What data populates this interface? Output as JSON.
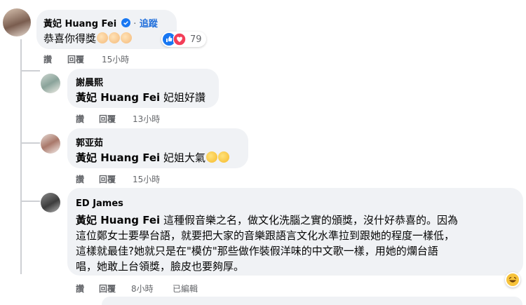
{
  "comments": [
    {
      "author": "黃妃 Huang Fei",
      "follow_label": "追蹤",
      "text": "恭喜你得獎",
      "reaction_count": "79",
      "actions": {
        "like": "讚",
        "reply": "回覆",
        "time": "15小時"
      }
    },
    {
      "author": "謝晨熙",
      "mention": "黃妃 Huang Fei",
      "text": " 妃姐好讚",
      "actions": {
        "like": "讚",
        "reply": "回覆",
        "time": "13小時"
      }
    },
    {
      "author": "郭亚茹",
      "mention": "黃妃 Huang Fei",
      "text": " 妃姐大氣",
      "actions": {
        "like": "讚",
        "reply": "回覆",
        "time": "15小時"
      }
    },
    {
      "author": "ED James",
      "mention": "黃妃 Huang Fei",
      "line1": " 這種假音樂之名，做文化洗腦之實的頒獎，沒什好恭喜的。因為",
      "line2": "這位鄭女士要學台語，就要把大家的音樂跟語言文化水準拉到跟她的程度一樣低，",
      "line3": "這樣就最佳?她就只是在\"模仿\"那些做作裝假洋味的中文歌一樣，用她的爛台語",
      "line4": "唱，她敢上台領獎，臉皮也要夠厚。",
      "actions": {
        "like": "讚",
        "reply": "回覆",
        "time": "8小時",
        "edited": "已編輯"
      }
    }
  ],
  "icons": {
    "verified": "verified-badge-icon",
    "like": "like-reaction-icon",
    "love": "love-reaction-icon",
    "clap": "clapping-hands-icon",
    "laugh": "laughing-emoji-icon"
  },
  "colors": {
    "bubble": "#f0f2f5",
    "link": "#216fdb",
    "secondary_text": "#65676b",
    "like_blue": "#1877f2",
    "love_red": "#f33e58"
  }
}
